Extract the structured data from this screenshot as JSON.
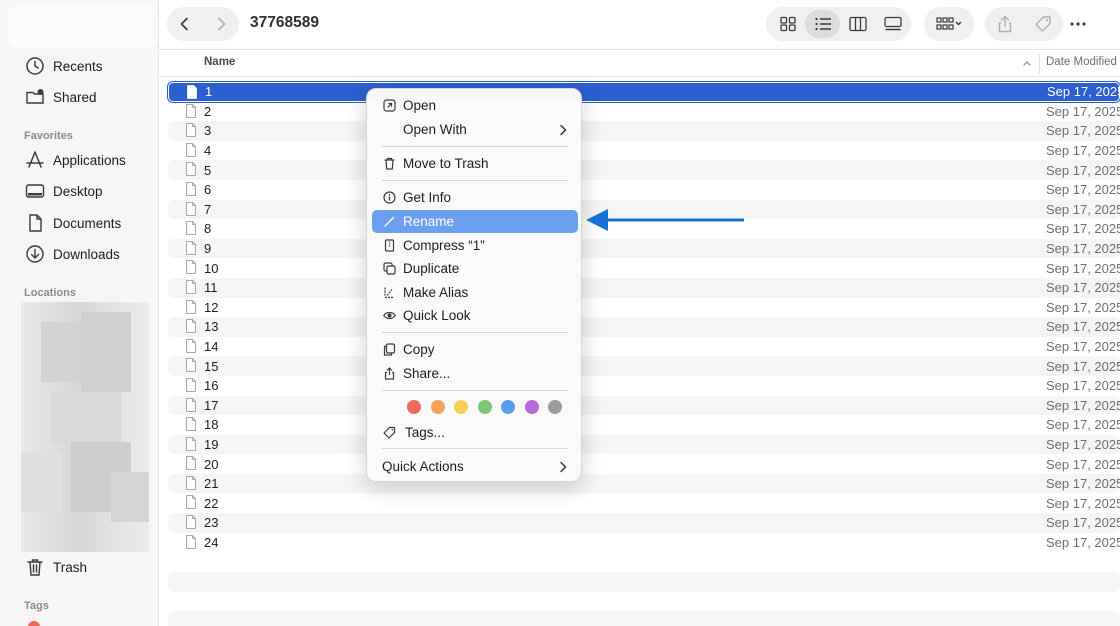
{
  "window": {
    "title": "37768589"
  },
  "sidebar": {
    "top_items": [
      {
        "label": "Recents",
        "icon": "clock-icon"
      },
      {
        "label": "Shared",
        "icon": "shared-folder-icon"
      }
    ],
    "favorites_title": "Favorites",
    "favorites": [
      {
        "label": "Applications",
        "icon": "applications-icon"
      },
      {
        "label": "Desktop",
        "icon": "desktop-icon"
      },
      {
        "label": "Documents",
        "icon": "document-icon"
      },
      {
        "label": "Downloads",
        "icon": "download-icon"
      }
    ],
    "locations_title": "Locations",
    "trash_label": "Trash",
    "tags_title": "Tags"
  },
  "toolbar": {
    "back_icon": "chevron-left-icon",
    "forward_icon": "chevron-right-icon",
    "view_modes": [
      "icon-view",
      "list-view",
      "column-view",
      "gallery-view"
    ],
    "active_view": "list-view",
    "group_icon": "group-by-icon",
    "share_icon": "share-icon",
    "tag_icon": "tag-icon",
    "more_icon": "ellipsis-icon"
  },
  "columns": {
    "name": "Name",
    "date_modified": "Date Modified"
  },
  "files": [
    {
      "name": "1",
      "date": "Sep 17, 2025",
      "selected": true
    },
    {
      "name": "2",
      "date": "Sep 17, 2025"
    },
    {
      "name": "3",
      "date": "Sep 17, 2025"
    },
    {
      "name": "4",
      "date": "Sep 17, 2025"
    },
    {
      "name": "5",
      "date": "Sep 17, 2025"
    },
    {
      "name": "6",
      "date": "Sep 17, 2025"
    },
    {
      "name": "7",
      "date": "Sep 17, 2025"
    },
    {
      "name": "8",
      "date": "Sep 17, 2025"
    },
    {
      "name": "9",
      "date": "Sep 17, 2025"
    },
    {
      "name": "10",
      "date": "Sep 17, 2025"
    },
    {
      "name": "11",
      "date": "Sep 17, 2025"
    },
    {
      "name": "12",
      "date": "Sep 17, 2025"
    },
    {
      "name": "13",
      "date": "Sep 17, 2025"
    },
    {
      "name": "14",
      "date": "Sep 17, 2025"
    },
    {
      "name": "15",
      "date": "Sep 17, 2025"
    },
    {
      "name": "16",
      "date": "Sep 17, 2025"
    },
    {
      "name": "17",
      "date": "Sep 17, 2025"
    },
    {
      "name": "18",
      "date": "Sep 17, 2025"
    },
    {
      "name": "19",
      "date": "Sep 17, 2025"
    },
    {
      "name": "20",
      "date": "Sep 17, 2025"
    },
    {
      "name": "21",
      "date": "Sep 17, 2025"
    },
    {
      "name": "22",
      "date": "Sep 17, 2025"
    },
    {
      "name": "23",
      "date": "Sep 17, 2025"
    },
    {
      "name": "24",
      "date": "Sep 17, 2025"
    }
  ],
  "context_menu": {
    "open": "Open",
    "open_with": "Open With",
    "move_to_trash": "Move to Trash",
    "get_info": "Get Info",
    "rename": "Rename",
    "compress": "Compress “1”",
    "duplicate": "Duplicate",
    "make_alias": "Make Alias",
    "quick_look": "Quick Look",
    "copy": "Copy",
    "share": "Share...",
    "tags": "Tags...",
    "quick_actions": "Quick Actions",
    "highlighted": "Rename",
    "tag_colors": [
      "#ec6a5e",
      "#f2a35e",
      "#f4cf57",
      "#7cc778",
      "#5b9cf0",
      "#b66bd8",
      "#9b9b9b"
    ]
  },
  "colors": {
    "selection": "#2d5fd0",
    "menu_highlight": "#6a9ff0",
    "annotation_arrow": "#1670d8"
  }
}
